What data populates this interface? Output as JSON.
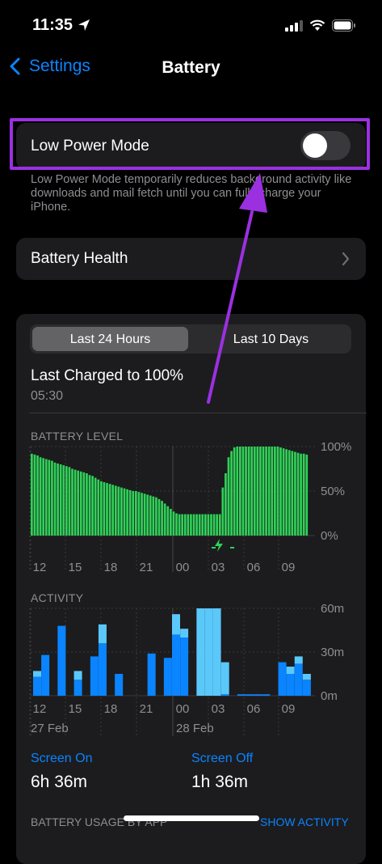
{
  "status": {
    "time": "11:35"
  },
  "nav": {
    "back_label": "Settings",
    "title": "Battery"
  },
  "low_power": {
    "label": "Low Power Mode",
    "enabled": false,
    "footnote": "Low Power Mode temporarily reduces background activity like downloads and mail fetch until you can fully charge your iPhone."
  },
  "battery_health": {
    "label": "Battery Health"
  },
  "segments": {
    "last24": "Last 24 Hours",
    "last10": "Last 10 Days",
    "selected": "last24"
  },
  "last_charged": {
    "title": "Last Charged to 100%",
    "time": "05:30"
  },
  "colors": {
    "accent": "#0a84ff",
    "battery_green": "#30d158",
    "screen_on": "#0a84ff",
    "screen_off": "#5ac8fa",
    "highlight": "#9b30e0"
  },
  "chart_data": [
    {
      "type": "bar",
      "title": "BATTERY LEVEL",
      "y_ticks": [
        "100%",
        "50%",
        "0%"
      ],
      "ylim": [
        0,
        100
      ],
      "x_ticks": [
        "12",
        "15",
        "18",
        "21",
        "00",
        "03",
        "06",
        "09"
      ],
      "values": [
        92,
        91,
        90,
        88,
        87,
        86,
        85,
        84,
        82,
        81,
        80,
        79,
        78,
        77,
        75,
        74,
        73,
        72,
        71,
        70,
        68,
        67,
        65,
        63,
        61,
        60,
        59,
        58,
        57,
        56,
        55,
        54,
        53,
        52,
        51,
        50,
        50,
        49,
        48,
        47,
        46,
        45,
        44,
        43,
        41,
        39,
        36,
        33,
        30,
        27,
        25,
        24,
        24,
        24,
        24,
        24,
        24,
        24,
        24,
        24,
        24,
        24,
        24,
        24,
        24,
        24,
        54,
        70,
        88,
        95,
        99,
        100,
        100,
        100,
        100,
        100,
        100,
        100,
        100,
        100,
        100,
        100,
        100,
        100,
        100,
        100,
        99,
        98,
        97,
        96,
        95,
        94,
        93,
        92,
        92,
        91
      ],
      "charging_icon_at": "03"
    },
    {
      "type": "bar",
      "title": "ACTIVITY",
      "y_ticks": [
        "60m",
        "30m",
        "0m"
      ],
      "ylim": [
        0,
        60
      ],
      "x_ticks": [
        "12",
        "15",
        "18",
        "21",
        "00",
        "03",
        "06",
        "09"
      ],
      "date_labels": [
        "27 Feb",
        "28 Feb"
      ],
      "series": [
        {
          "name": "Screen On",
          "values": [
            13,
            28,
            0,
            48,
            0,
            11,
            0,
            27,
            36,
            0,
            15,
            0,
            0,
            0,
            29,
            0,
            26,
            42,
            40,
            0,
            0,
            0,
            0,
            1,
            0,
            1,
            1,
            1,
            1,
            0,
            23,
            15,
            22,
            11
          ]
        },
        {
          "name": "Screen Off",
          "values": [
            4,
            0,
            0,
            0,
            0,
            6,
            0,
            0,
            13,
            0,
            0,
            0,
            0,
            0,
            0,
            0,
            0,
            14,
            6,
            0,
            60,
            60,
            60,
            22,
            0,
            0,
            0,
            0,
            0,
            0,
            0,
            5,
            5,
            4
          ]
        }
      ],
      "x_positions": [
        0,
        1,
        2,
        3,
        4,
        5,
        6,
        7,
        8,
        9,
        10,
        11,
        12,
        13,
        14,
        15,
        16,
        17,
        18,
        19,
        20,
        21,
        22,
        23,
        24,
        25,
        26,
        27,
        28,
        29,
        30,
        31,
        32,
        33
      ]
    }
  ],
  "summary": {
    "screen_on_label": "Screen On",
    "screen_on_value": "6h 36m",
    "screen_off_label": "Screen Off",
    "screen_off_value": "1h 36m"
  },
  "usage": {
    "label": "BATTERY USAGE BY APP",
    "show_activity": "SHOW ACTIVITY"
  }
}
